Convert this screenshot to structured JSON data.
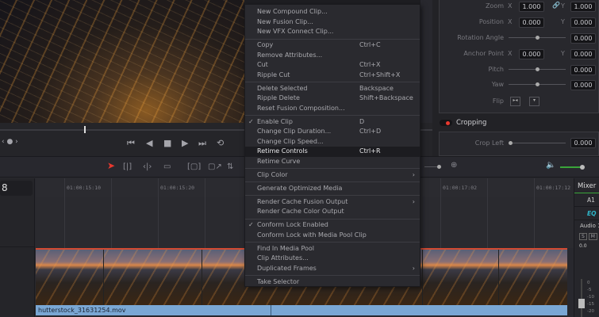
{
  "menu": {
    "groups": [
      [
        {
          "label": "New Compound Clip..."
        },
        {
          "label": "New Fusion Clip..."
        },
        {
          "label": "New VFX Connect Clip..."
        }
      ],
      [
        {
          "label": "Copy",
          "shortcut": "Ctrl+C"
        },
        {
          "label": "Remove Attributes..."
        },
        {
          "label": "Cut",
          "shortcut": "Ctrl+X"
        },
        {
          "label": "Ripple Cut",
          "shortcut": "Ctrl+Shift+X"
        }
      ],
      [
        {
          "label": "Delete Selected",
          "shortcut": "Backspace"
        },
        {
          "label": "Ripple Delete",
          "shortcut": "Shift+Backspace"
        },
        {
          "label": "Reset Fusion Composition..."
        }
      ],
      [
        {
          "label": "Enable Clip",
          "shortcut": "D",
          "checked": true
        },
        {
          "label": "Change Clip Duration...",
          "shortcut": "Ctrl+D"
        },
        {
          "label": "Change Clip Speed..."
        },
        {
          "label": "Retime Controls",
          "shortcut": "Ctrl+R",
          "highlighted": true
        },
        {
          "label": "Retime Curve"
        }
      ],
      [
        {
          "label": "Clip Color",
          "submenu": true
        }
      ],
      [
        {
          "label": "Generate Optimized Media"
        }
      ],
      [
        {
          "label": "Render Cache Fusion Output",
          "submenu": true
        },
        {
          "label": "Render Cache Color Output"
        }
      ],
      [
        {
          "label": "Conform Lock Enabled",
          "checked": true
        },
        {
          "label": "Conform Lock with Media Pool Clip"
        }
      ],
      [
        {
          "label": "Find In Media Pool"
        },
        {
          "label": "Clip Attributes..."
        },
        {
          "label": "Duplicated Frames",
          "submenu": true
        }
      ],
      [
        {
          "label": "Take Selector"
        }
      ]
    ]
  },
  "inspector": {
    "zoom": {
      "label": "Zoom",
      "x_label": "X",
      "x": "1.000",
      "y_label": "Y",
      "y": "1.000"
    },
    "position": {
      "label": "Position",
      "x_label": "X",
      "x": "0.000",
      "y_label": "Y",
      "y": "0.000"
    },
    "rotation": {
      "label": "Rotation Angle",
      "value": "0.000",
      "slider": 0.5
    },
    "anchor": {
      "label": "Anchor Point",
      "x_label": "X",
      "x": "0.000",
      "y_label": "Y",
      "y": "0.000"
    },
    "pitch": {
      "label": "Pitch",
      "value": "0.000",
      "slider": 0.5
    },
    "yaw": {
      "label": "Yaw",
      "value": "0.000",
      "slider": 0.5
    },
    "flip": {
      "label": "Flip"
    },
    "cropping": {
      "label": "Cropping",
      "enabled": true,
      "accent": "#e8382e"
    },
    "crop_left": {
      "label": "Crop Left",
      "value": "0.000",
      "slider": 0.0
    }
  },
  "timeline": {
    "timecode": "8",
    "ruler": [
      "01:00:15:10",
      "01:00:15:20",
      "01:00:17:02",
      "01:00:17:12"
    ],
    "clip_name": "hutterstock_31631254.mov"
  },
  "mixer": {
    "title": "Mixer",
    "track": "A1",
    "eq": "EQ",
    "audio": "Audio 1",
    "solo": "S",
    "mute": "M",
    "level": "0.0",
    "scale": [
      "0",
      "-5",
      "-10",
      "-15",
      "-20"
    ]
  },
  "colors": {
    "clip_bar": "#7aa7d4",
    "clip_border": "#d24a32",
    "selection_tool": "#e8382e",
    "eq": "#2fb5c8",
    "volume": "#3aa53a"
  }
}
